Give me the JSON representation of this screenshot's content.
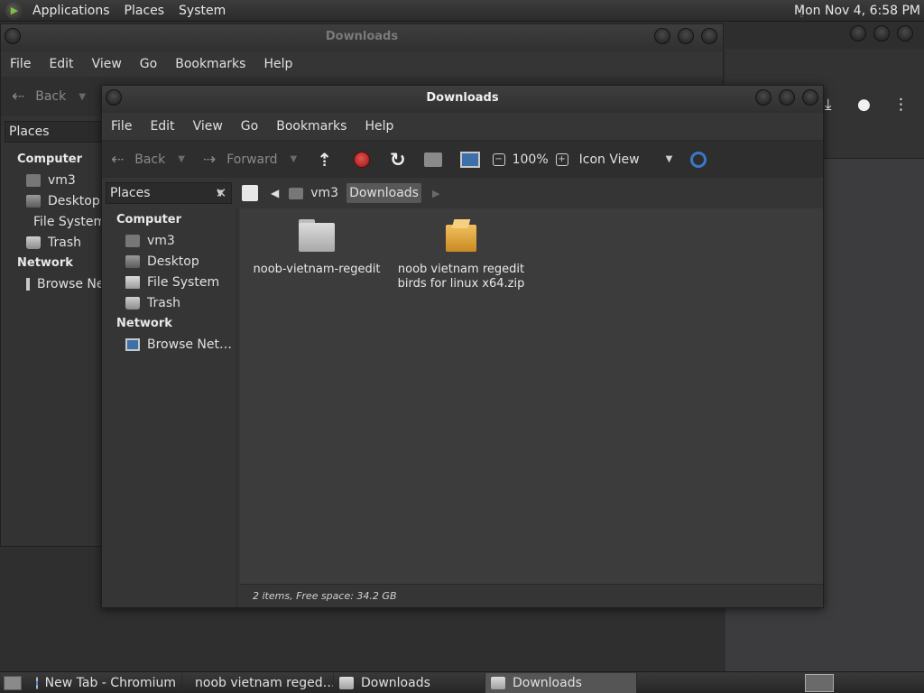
{
  "top_panel": {
    "menus": [
      "Applications",
      "Places",
      "System"
    ],
    "clock": "Mon Nov  4,  6:58 PM"
  },
  "back_window": {
    "title": "Downloads",
    "menus": [
      "File",
      "Edit",
      "View",
      "Go",
      "Bookmarks",
      "Help"
    ],
    "back_label": "Back",
    "places_label": "Places",
    "sidebar": {
      "computer_header": "Computer",
      "items": [
        "vm3",
        "Desktop",
        "File System",
        "Trash"
      ],
      "network_header": "Network",
      "network_items": [
        "Browse Network"
      ]
    }
  },
  "main_window": {
    "title": "Downloads",
    "menus": [
      "File",
      "Edit",
      "View",
      "Go",
      "Bookmarks",
      "Help"
    ],
    "toolbar": {
      "back": "Back",
      "forward": "Forward",
      "zoom": "100%",
      "view_mode": "Icon View"
    },
    "places_combo": "Places",
    "path": [
      "vm3",
      "Downloads"
    ],
    "sidebar": {
      "computer_header": "Computer",
      "items": [
        "vm3",
        "Desktop",
        "File System",
        "Trash"
      ],
      "network_header": "Network",
      "network_items": [
        "Browse Net…"
      ]
    },
    "files": [
      {
        "name": "noob-vietnam-regedit",
        "type": "folder"
      },
      {
        "name": "noob vietnam regedit birds for linux x64.zip",
        "type": "zip"
      }
    ],
    "status": "2 items, Free space: 34.2 GB"
  },
  "taskbar": {
    "tasks": [
      "New Tab - Chromium",
      "noob vietnam reged…",
      "Downloads",
      "Downloads"
    ]
  },
  "colors": {
    "stop": "#d23030",
    "folder": "#c8c8c8",
    "zip": "#e0a030",
    "desktop_bg": "#2f2f2f"
  }
}
